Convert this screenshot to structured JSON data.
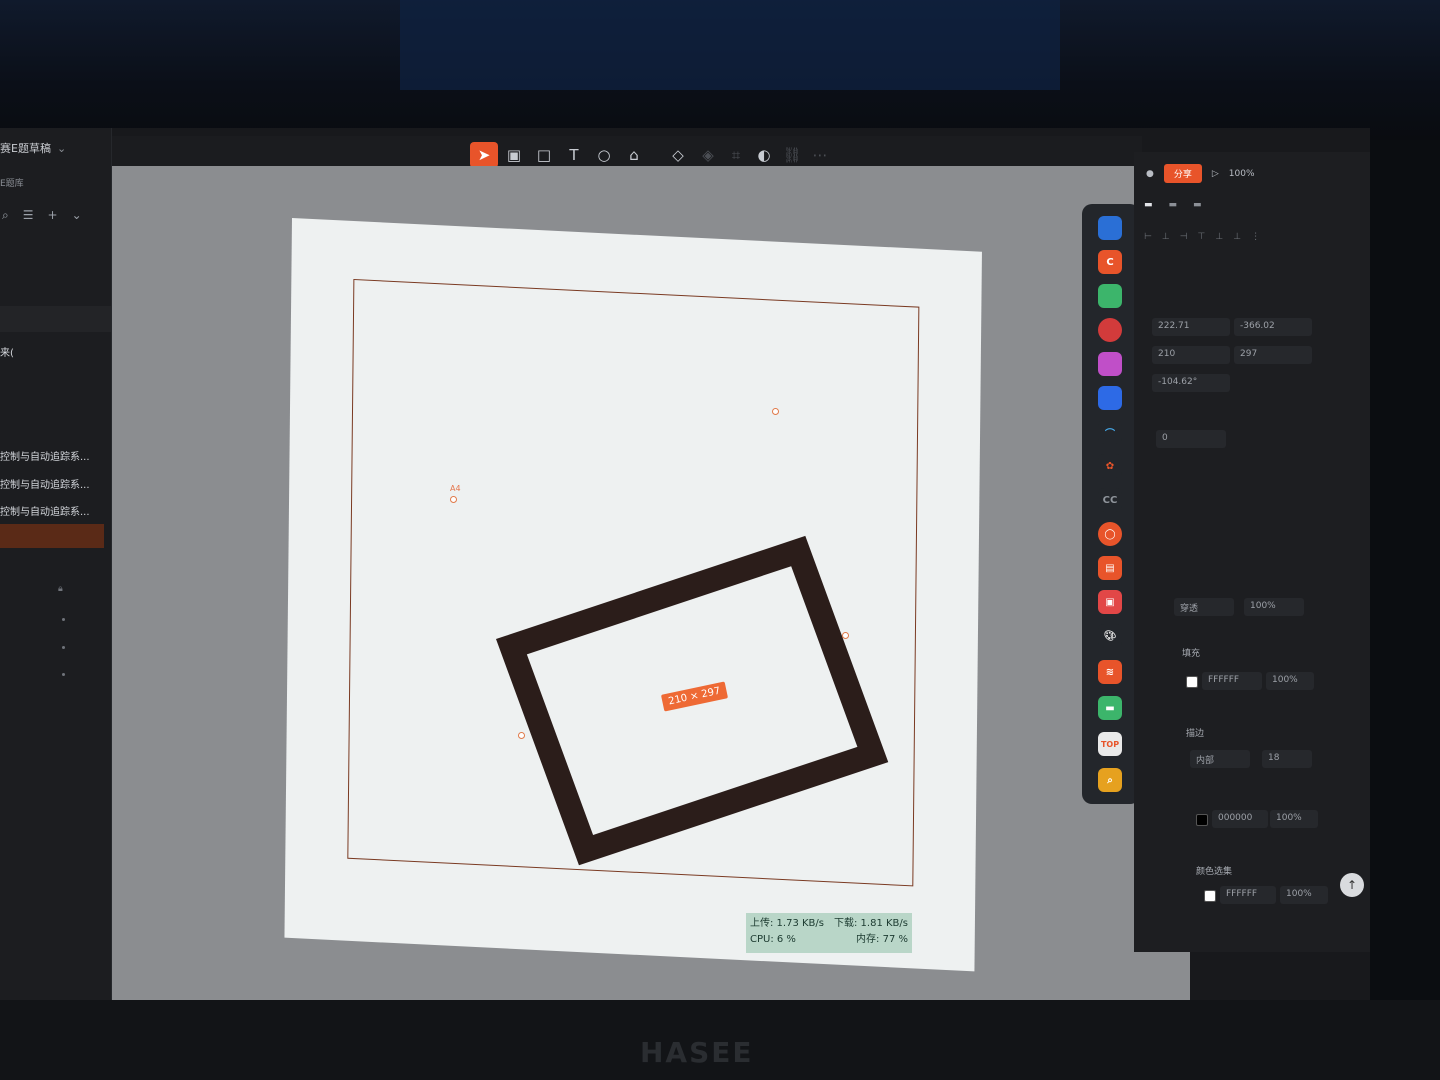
{
  "left_panel": {
    "file_title": "赛E题草稿",
    "subtitle": "E题库",
    "item_prefix": "来(",
    "items": [
      {
        "label": "控制与自动追踪系..."
      },
      {
        "label": "控制与自动追踪系..."
      },
      {
        "label": "控制与自动追踪系..."
      }
    ]
  },
  "canvas": {
    "frame_label": "A4",
    "size_badge": "210 × 297"
  },
  "status_monitor": {
    "upload": "上传: 1.73 KB/s",
    "download": "下载: 1.81 KB/s",
    "cpu": "CPU: 6 %",
    "memory": "内存: 77 %"
  },
  "right_panel": {
    "share_label": "分享",
    "zoom_value": "100%",
    "position": {
      "x": "222.71",
      "y": "-366.02"
    },
    "size": {
      "w": "210",
      "h": "297"
    },
    "rotation": "-104.62°",
    "corner_radius": "0",
    "layer": {
      "mode": "穿透",
      "opacity": "100%"
    },
    "fill": {
      "label": "填充",
      "color": "FFFFFF",
      "opacity": "100%"
    },
    "stroke": {
      "label": "描边",
      "position": "内部",
      "width": "18",
      "color": "000000",
      "opacity": "100%"
    },
    "export": {
      "label": "颜色选集",
      "color": "FFFFFF",
      "opacity": "100%"
    }
  },
  "brand": "HASEE",
  "colors": {
    "accent": "#e8542a",
    "rect_stroke": "#2b1d1a",
    "canvas_bg": "#8b8d90",
    "artboard": "#eef1f1"
  }
}
